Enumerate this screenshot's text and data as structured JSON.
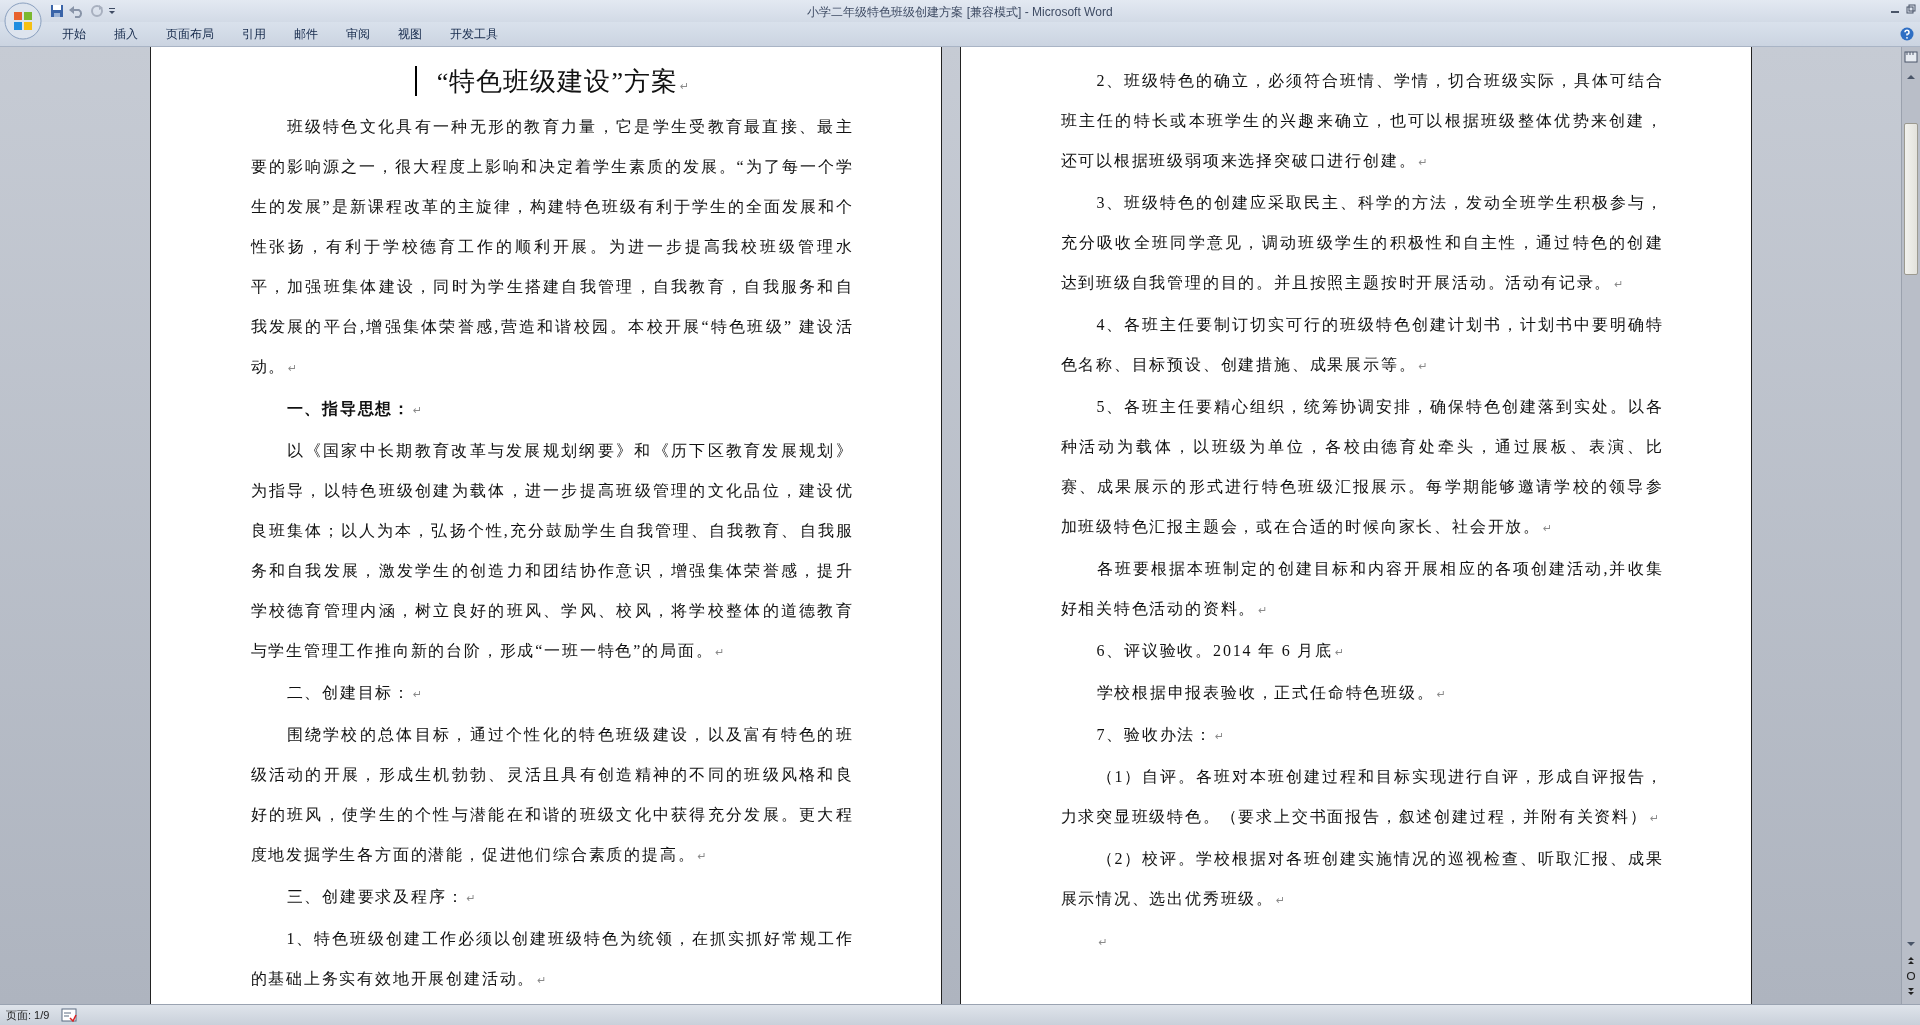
{
  "window": {
    "title": "小学二年级特色班级创建方案 [兼容模式] - Microsoft Word"
  },
  "ribbon_tabs": [
    {
      "label": "开始"
    },
    {
      "label": "插入"
    },
    {
      "label": "页面布局"
    },
    {
      "label": "引用"
    },
    {
      "label": "邮件"
    },
    {
      "label": "审阅"
    },
    {
      "label": "视图"
    },
    {
      "label": "开发工具"
    }
  ],
  "pages": [
    {
      "paragraphs": [
        {
          "kind": "title",
          "text": "“特色班级建设”方案",
          "mark": "↵",
          "caret": true
        },
        {
          "kind": "body",
          "text": "班级特色文化具有一种无形的教育力量，它是学生受教育最直接、最主要的影响源之一，很大程度上影响和决定着学生素质的发展。“为了每一个学生的发展”是新课程改革的主旋律，构建特色班级有利于学生的全面发展和个性张扬，有利于学校德育工作的顺利开展。为进一步提高我校班级管理水平，加强班集体建设，同时为学生搭建自我管理，自我教育，自我服务和自我发展的平台,增强集体荣誉感,营造和谐校园。本校开展“特色班级” 建设活动。",
          "mark": "↵"
        },
        {
          "kind": "bold",
          "text": "一、指导思想：",
          "mark": "↵"
        },
        {
          "kind": "body",
          "text": "以《国家中长期教育改革与发展规划纲要》和《历下区教育发展规划》为指导，以特色班级创建为载体，进一步提高班级管理的文化品位，建设优良班集体；以人为本，弘扬个性,充分鼓励学生自我管理、自我教育、自我服务和自我发展，激发学生的创造力和团结协作意识，增强集体荣誉感，提升学校德育管理内涵，树立良好的班风、学风、校风，将学校整体的道德教育与学生管理工作推向新的台阶，形成“一班一特色”的局面。",
          "mark": "↵"
        },
        {
          "kind": "body",
          "text": "二、创建目标：",
          "mark": "↵"
        },
        {
          "kind": "body",
          "text": "围绕学校的总体目标，通过个性化的特色班级建设，以及富有特色的班级活动的开展，形成生机勃勃、灵活且具有创造精神的不同的班级风格和良好的班风，使学生的个性与潜能在和谐的班级文化中获得充分发展。更大程度地发掘学生各方面的潜能，促进他们综合素质的提高。",
          "mark": "↵"
        },
        {
          "kind": "body",
          "text": "三、创建要求及程序：",
          "mark": "↵"
        },
        {
          "kind": "body",
          "text": "1、特色班级创建工作必须以创建班级特色为统领，在抓实抓好常规工作的基础上务实有效地开展创建活动。",
          "mark": "↵"
        }
      ]
    },
    {
      "paragraphs": [
        {
          "kind": "body",
          "text": "2、班级特色的确立，必须符合班情、学情，切合班级实际，具体可结合班主任的特长或本班学生的兴趣来确立，也可以根据班级整体优势来创建，还可以根据班级弱项来选择突破口进行创建。",
          "mark": "↵"
        },
        {
          "kind": "body",
          "text": "3、班级特色的创建应采取民主、科学的方法，发动全班学生积极参与，充分吸收全班同学意见，调动班级学生的积极性和自主性，通过特色的创建达到班级自我管理的目的。并且按照主题按时开展活动。活动有记录。",
          "mark": "↵"
        },
        {
          "kind": "body",
          "text": "4、各班主任要制订切实可行的班级特色创建计划书，计划书中要明确特色名称、目标预设、创建措施、成果展示等。",
          "mark": "↵"
        },
        {
          "kind": "body",
          "text": "5、各班主任要精心组织，统筹协调安排，确保特色创建落到实处。以各种活动为载体，以班级为单位，各校由德育处牵头，通过展板、表演、比赛、成果展示的形式进行特色班级汇报展示。每学期能够邀请学校的领导参加班级特色汇报主题会，或在合适的时候向家长、社会开放。",
          "mark": "↵"
        },
        {
          "kind": "body",
          "text": "各班要根据本班制定的创建目标和内容开展相应的各项创建活动,并收集好相关特色活动的资料。",
          "mark": "↵"
        },
        {
          "kind": "body",
          "text": "6、评议验收。2014 年 6 月底",
          "mark": "↵"
        },
        {
          "kind": "body",
          "text": "学校根据申报表验收，正式任命特色班级。",
          "mark": "↵"
        },
        {
          "kind": "body",
          "text": "7、验收办法：",
          "mark": "↵"
        },
        {
          "kind": "body",
          "text": "（1）自评。各班对本班创建过程和目标实现进行自评，形成自评报告，力求突显班级特色。（要求上交书面报告，叙述创建过程，并附有关资料）",
          "mark": "↵"
        },
        {
          "kind": "body",
          "text": "（2）校评。学校根据对各班创建实施情况的巡视检查、听取汇报、成果展示情况、选出优秀班级。",
          "mark": "↵"
        },
        {
          "kind": "empty",
          "mark": "↵"
        }
      ]
    }
  ],
  "status_bar": {
    "page_indicator": "页面: 1/9"
  }
}
